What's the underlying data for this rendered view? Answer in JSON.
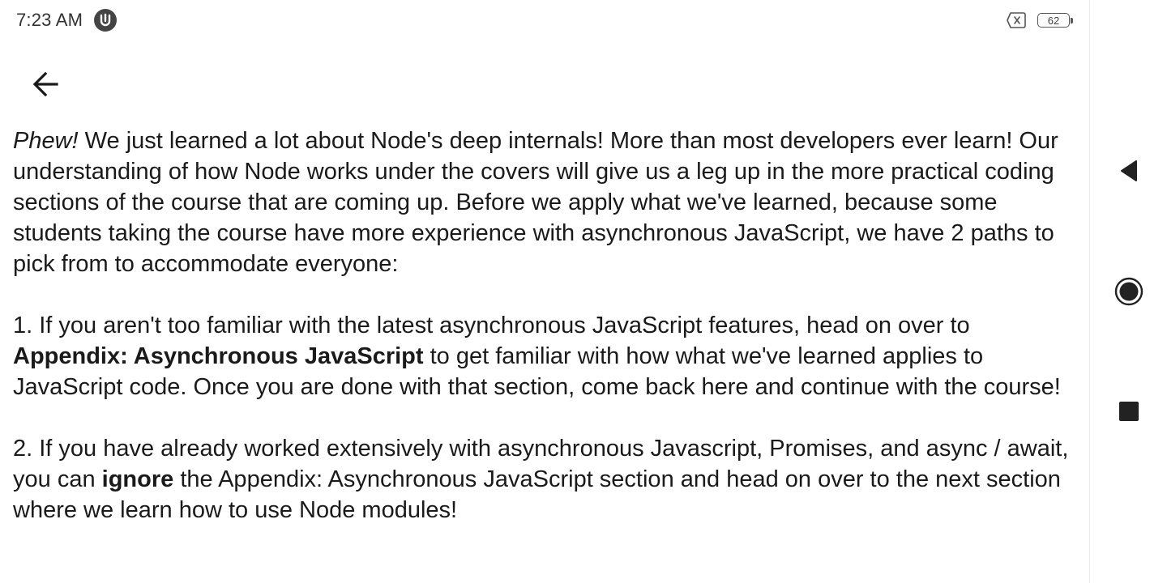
{
  "status_bar": {
    "time": "7:23 AM",
    "notification_icon": "u-shield-icon",
    "sim_icon": "no-sim-icon",
    "battery_level": "62"
  },
  "toolbar": {
    "back_icon": "arrow-left-icon"
  },
  "article": {
    "p1": {
      "lead_italic": "Phew!",
      "text": " We just learned a lot about Node's deep internals! More than most developers ever learn! Our understanding of how Node works under the covers will give us a leg up in the more practical coding sections of the course that are coming up. Before we apply what we've learned, because some students taking the course have more experience with asynchronous JavaScript, we have 2 paths to pick from to accommodate everyone:"
    },
    "p2": {
      "text_a": "1. If you aren't too familiar with the latest asynchronous JavaScript features, head on over to ",
      "bold": "Appendix: Asynchronous JavaScript",
      "text_b": " to get familiar with how what we've learned applies to JavaScript code. Once you are done with that section, come back here and continue with the course!"
    },
    "p3": {
      "text_a": "2. If you have already worked extensively with asynchronous Javascript, Promises, and async / await, you can ",
      "bold": "ignore",
      "text_b": " the Appendix: Asynchronous JavaScript section and head on over to the next section where we learn how to use Node modules!"
    }
  },
  "nav_bar": {
    "back_icon": "triangle-back-icon",
    "home_icon": "circle-home-icon",
    "recents_icon": "square-recents-icon"
  }
}
